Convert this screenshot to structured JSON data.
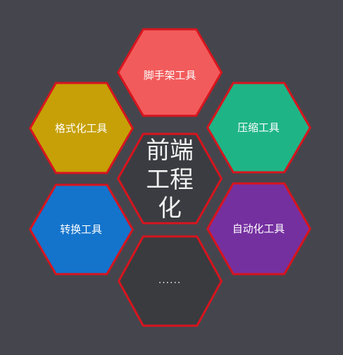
{
  "center": {
    "lines": [
      "前端",
      "工程",
      "化"
    ],
    "fill": "#3b3c41"
  },
  "border_color": "#d8141e",
  "hexagons": [
    {
      "id": "scaffold",
      "label": "脚手架工具",
      "fill": "#f25b5b"
    },
    {
      "id": "format",
      "label": "格式化工具",
      "fill": "#c6a006"
    },
    {
      "id": "compress",
      "label": "压缩工具",
      "fill": "#1fb486"
    },
    {
      "id": "convert",
      "label": "转换工具",
      "fill": "#1474cc"
    },
    {
      "id": "automation",
      "label": "自动化工具",
      "fill": "#7530a0"
    },
    {
      "id": "more",
      "label": "......",
      "fill": "#3a3b3e"
    }
  ]
}
